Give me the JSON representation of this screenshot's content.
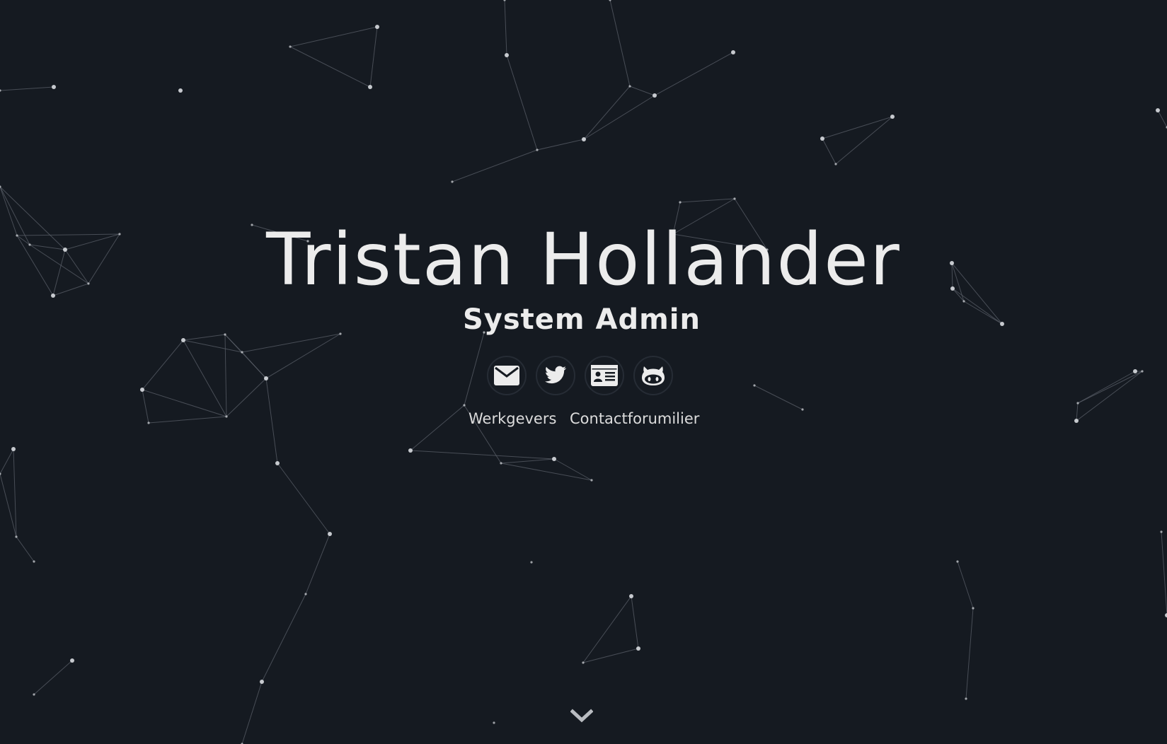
{
  "hero": {
    "name": "Tristan Hollander",
    "role": "System Admin"
  },
  "social": [
    {
      "id": "email",
      "icon": "envelope-icon"
    },
    {
      "id": "twitter",
      "icon": "twitter-bird-icon"
    },
    {
      "id": "vcard",
      "icon": "id-card-icon"
    },
    {
      "id": "github",
      "icon": "github-octocat-icon"
    }
  ],
  "links": {
    "employers_label": "Werkgevers",
    "contact_label": "Contactforumilier"
  },
  "scroll": {
    "icon": "chevron-down-icon"
  },
  "colors": {
    "background": "#151a21",
    "text": "#ececec",
    "particle": "#d8dbe0",
    "line": "#5a5f68"
  }
}
